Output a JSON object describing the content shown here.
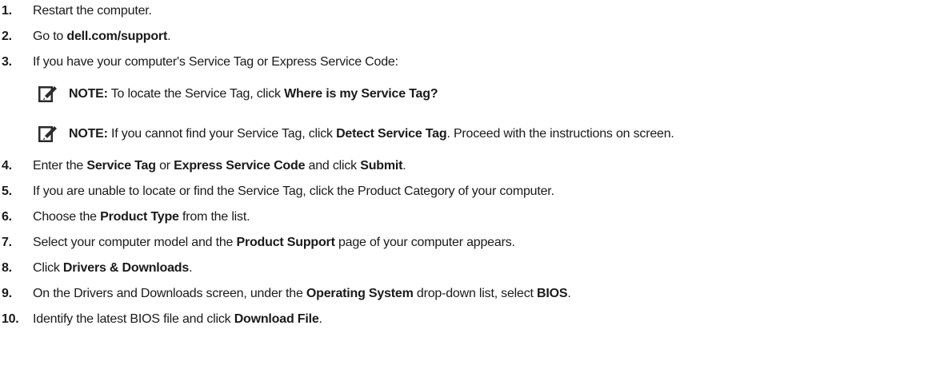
{
  "steps": [
    {
      "num": "1.",
      "parts": [
        "Restart the computer."
      ]
    },
    {
      "num": "2.",
      "parts": [
        "Go to ",
        "dell.com/support",
        "."
      ]
    },
    {
      "num": "3.",
      "parts": [
        "If you have your computer's Service Tag or Express Service Code:"
      ]
    },
    {
      "num": "4.",
      "parts": [
        "Enter the ",
        "Service Tag",
        " or ",
        "Express Service Code",
        " and click ",
        "Submit",
        "."
      ]
    },
    {
      "num": "5.",
      "parts": [
        "If you are unable to locate or find the Service Tag, click the Product Category of your computer."
      ]
    },
    {
      "num": "6.",
      "parts": [
        "Choose the ",
        "Product Type",
        " from the list."
      ]
    },
    {
      "num": "7.",
      "parts": [
        "Select your computer model and the ",
        "Product Support",
        " page of your computer appears."
      ]
    },
    {
      "num": "8.",
      "parts": [
        "Click ",
        "Drivers & Downloads",
        "."
      ]
    },
    {
      "num": "9.",
      "parts": [
        "On the Drivers and Downloads screen, under the ",
        "Operating System",
        " drop-down list, select ",
        "BIOS",
        "."
      ]
    },
    {
      "num": "10.",
      "parts": [
        "Identify the latest BIOS file and click ",
        "Download File",
        "."
      ]
    }
  ],
  "notes": [
    {
      "label": "NOTE:",
      "parts": [
        " To locate the Service Tag, click ",
        "Where is my Service Tag?"
      ]
    },
    {
      "label": "NOTE:",
      "parts": [
        " If you cannot find your Service Tag, click ",
        "Detect Service Tag",
        ". Proceed with the instructions on screen."
      ]
    }
  ],
  "icons": {
    "note": "pencil-note-icon"
  }
}
